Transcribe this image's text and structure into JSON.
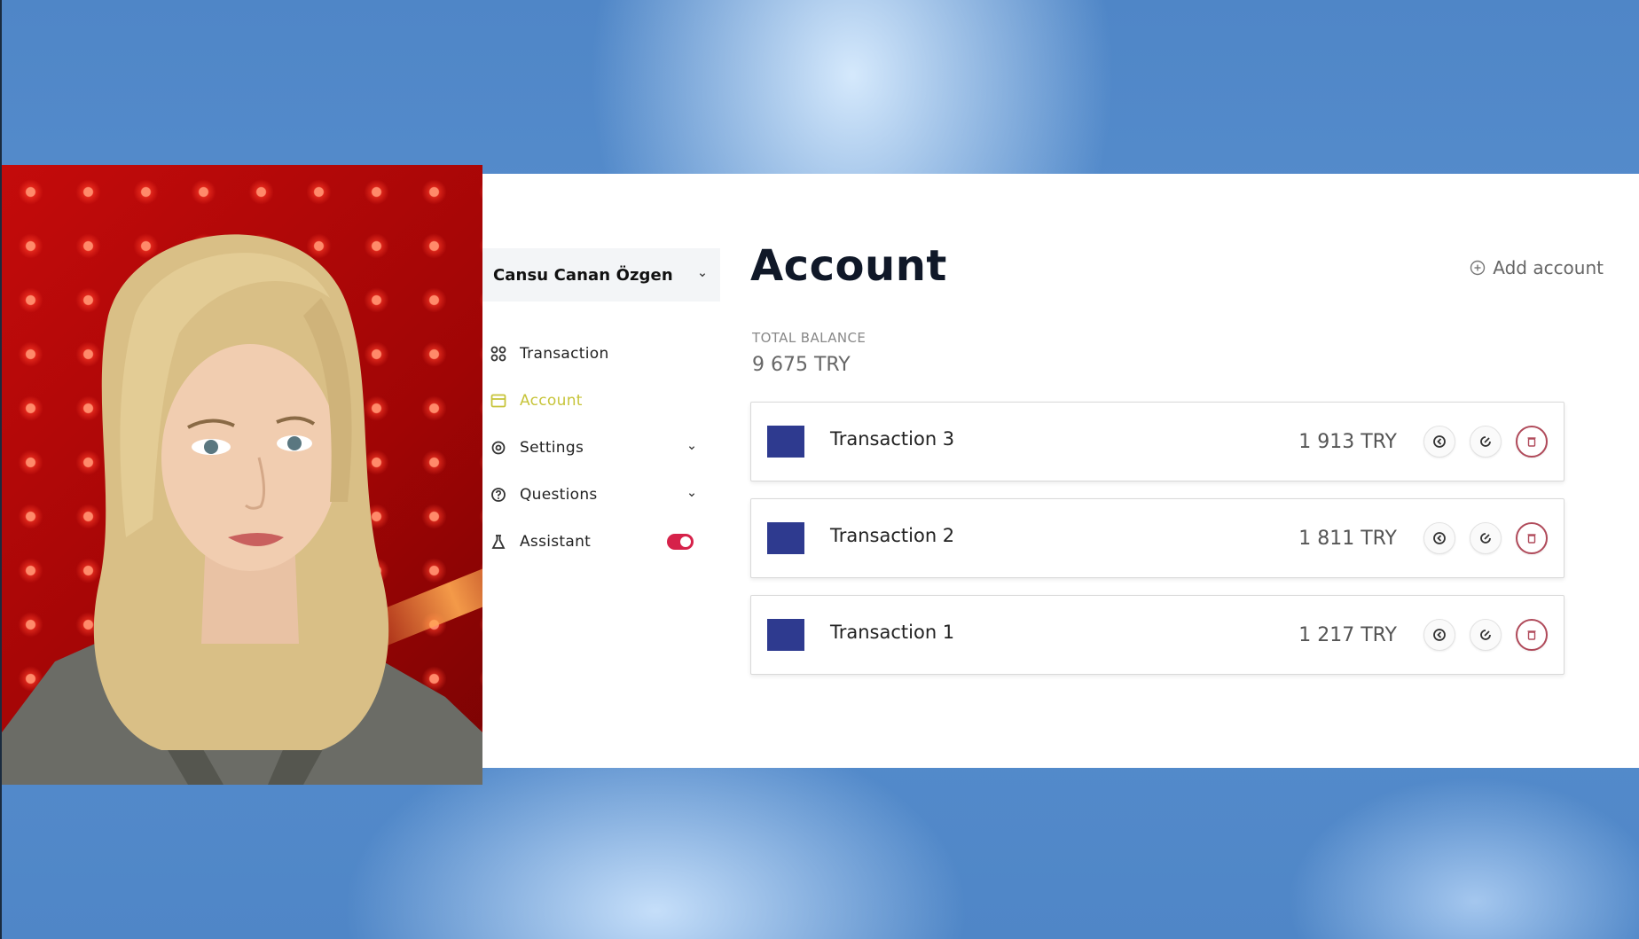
{
  "colors": {
    "accent_active": "#c7c43a",
    "toggle_on": "#d6224a",
    "swatch": "#2e3a8f",
    "delete_ring": "#b04a5a"
  },
  "sidebar": {
    "user_name": "Cansu Canan Özgen",
    "items": [
      {
        "label": "Transaction",
        "icon": "grid-icon",
        "active": false
      },
      {
        "label": "Account",
        "icon": "card-icon",
        "active": true
      },
      {
        "label": "Settings",
        "icon": "gear-icon",
        "active": false,
        "expandable": true
      },
      {
        "label": "Questions",
        "icon": "question-icon",
        "active": false,
        "expandable": true
      },
      {
        "label": "Assistant",
        "icon": "flask-icon",
        "active": false,
        "toggle": true,
        "toggle_on": true
      }
    ]
  },
  "main": {
    "title": "Account",
    "add_account_label": "Add account",
    "total_balance_label": "TOTAL BALANCE",
    "total_balance_value": "9 675 TRY",
    "transactions": [
      {
        "name": "Transaction 3",
        "amount": "1 913 TRY"
      },
      {
        "name": "Transaction 2",
        "amount": "1 811 TRY"
      },
      {
        "name": "Transaction 1",
        "amount": "1 217 TRY"
      }
    ],
    "row_actions": [
      "view-icon",
      "edit-icon",
      "trash-icon"
    ]
  }
}
